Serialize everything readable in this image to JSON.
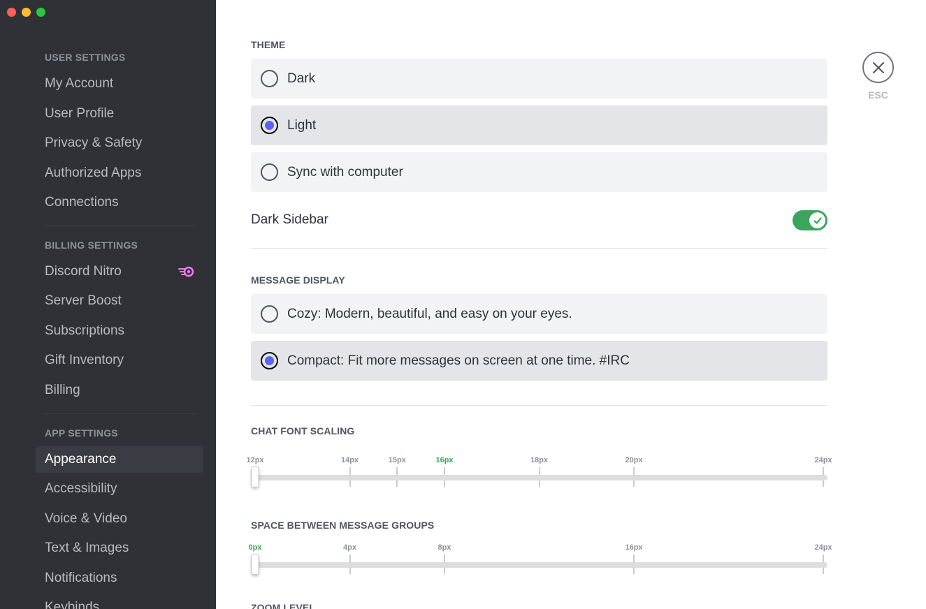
{
  "sidebar": {
    "sections": [
      {
        "header": "User Settings",
        "items": [
          {
            "label": "My Account"
          },
          {
            "label": "User Profile"
          },
          {
            "label": "Privacy & Safety"
          },
          {
            "label": "Authorized Apps"
          },
          {
            "label": "Connections"
          }
        ]
      },
      {
        "header": "Billing Settings",
        "items": [
          {
            "label": "Discord Nitro",
            "icon": "nitro-icon"
          },
          {
            "label": "Server Boost"
          },
          {
            "label": "Subscriptions"
          },
          {
            "label": "Gift Inventory"
          },
          {
            "label": "Billing"
          }
        ]
      },
      {
        "header": "App Settings",
        "items": [
          {
            "label": "Appearance",
            "active": true
          },
          {
            "label": "Accessibility"
          },
          {
            "label": "Voice & Video"
          },
          {
            "label": "Text & Images"
          },
          {
            "label": "Notifications"
          },
          {
            "label": "Keybinds"
          }
        ]
      }
    ]
  },
  "theme": {
    "title": "Theme",
    "options": [
      {
        "label": "Dark",
        "selected": false
      },
      {
        "label": "Light",
        "selected": true
      },
      {
        "label": "Sync with computer",
        "selected": false
      }
    ],
    "dark_sidebar": {
      "label": "Dark Sidebar",
      "enabled": true
    }
  },
  "message_display": {
    "title": "Message Display",
    "options": [
      {
        "label": "Cozy: Modern, beautiful, and easy on your eyes.",
        "selected": false
      },
      {
        "label": "Compact: Fit more messages on screen at one time. #IRC",
        "selected": true
      }
    ]
  },
  "chat_font_scaling": {
    "title": "Chat Font Scaling",
    "min": 12,
    "max": 24,
    "ticks": [
      "12px",
      "14px",
      "15px",
      "16px",
      "18px",
      "20px",
      "24px"
    ],
    "tick_values": [
      12,
      14,
      15,
      16,
      18,
      20,
      24
    ],
    "highlighted": "16px",
    "value": 12
  },
  "message_group_spacing": {
    "title": "Space Between Message Groups",
    "min": 0,
    "max": 24,
    "ticks": [
      "0px",
      "4px",
      "8px",
      "16px",
      "24px"
    ],
    "tick_values": [
      0,
      4,
      8,
      16,
      24
    ],
    "highlighted": "0px",
    "value": 0
  },
  "zoom_level": {
    "title": "Zoom Level"
  },
  "close": {
    "label": "ESC"
  },
  "colors": {
    "sidebar_bg": "#2f3136",
    "accent": "#5865f2",
    "toggle_on": "#3ba55d",
    "tick_active": "#3ba55d"
  }
}
